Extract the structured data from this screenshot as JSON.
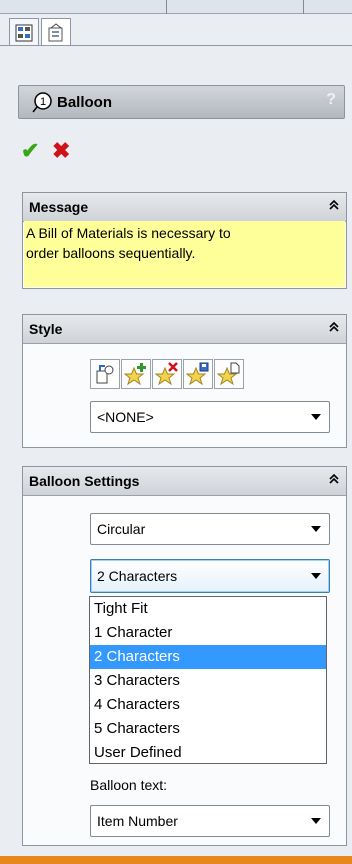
{
  "tabs": [
    {
      "name": "featuremanager-tab-icon"
    },
    {
      "name": "propertymanager-tab-icon"
    }
  ],
  "header": {
    "title": "Balloon",
    "help": "?"
  },
  "actions": {
    "ok": "✔",
    "cancel": "✖",
    "ok_color": "#3aa615",
    "cancel_color": "#d0121a"
  },
  "message": {
    "title": "Message",
    "lines": [
      "A Bill of Materials is necessary to",
      "order balloons sequentially."
    ]
  },
  "style": {
    "title": "Style",
    "icons": [
      "apply-style-icon",
      "add-style-icon",
      "delete-style-icon",
      "save-style-icon",
      "load-style-icon"
    ],
    "selected": "<NONE>"
  },
  "balloon_settings": {
    "title": "Balloon Settings",
    "style_value": "Circular",
    "size_value": "2 Characters",
    "size_options": [
      "Tight Fit",
      "1 Character",
      "2 Characters",
      "3 Characters",
      "4 Characters",
      "5 Characters",
      "User Defined"
    ],
    "size_selected_index": 2,
    "balloon_text_label": "Balloon text:",
    "balloon_text_value": "Item Number"
  },
  "chevron": "≈"
}
